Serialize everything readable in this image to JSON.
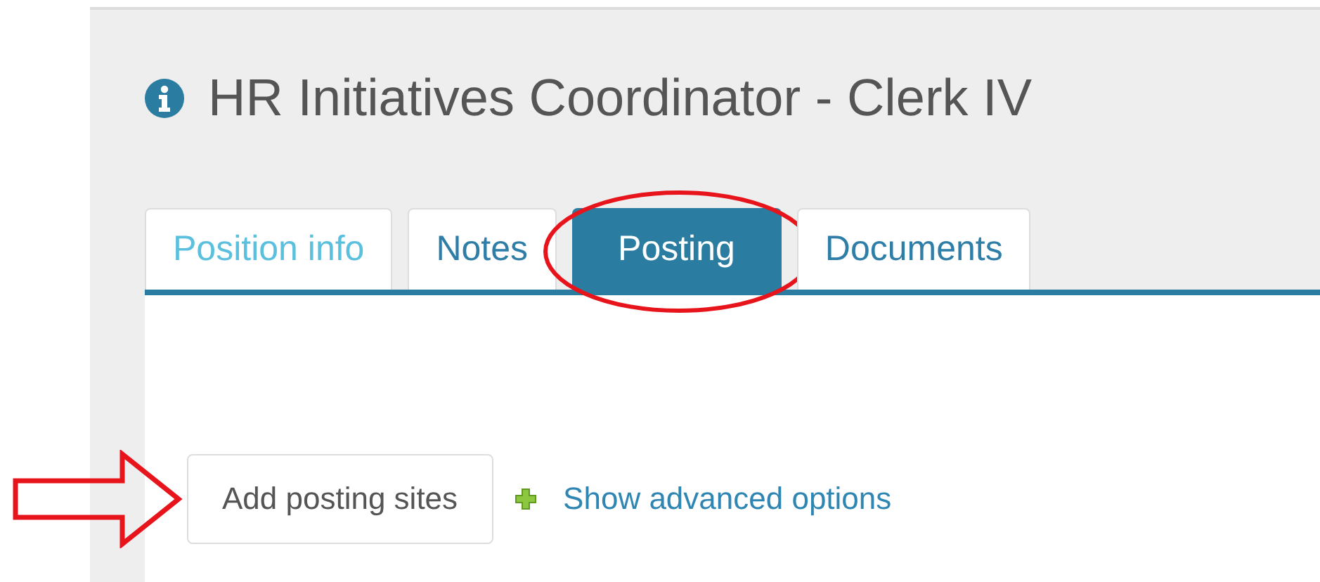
{
  "header": {
    "title": "HR Initiatives Coordinator - Clerk IV"
  },
  "tabs": [
    {
      "label": "Position info",
      "selected": false,
      "hover": true,
      "circled": false
    },
    {
      "label": "Notes",
      "selected": false,
      "hover": false,
      "circled": false
    },
    {
      "label": "Posting",
      "selected": true,
      "hover": false,
      "circled": true
    },
    {
      "label": "Documents",
      "selected": false,
      "hover": false,
      "circled": false
    }
  ],
  "actions": {
    "button": {
      "label": "Add posting sites",
      "arrow": true
    },
    "link": {
      "label": "Show advanced options"
    }
  }
}
